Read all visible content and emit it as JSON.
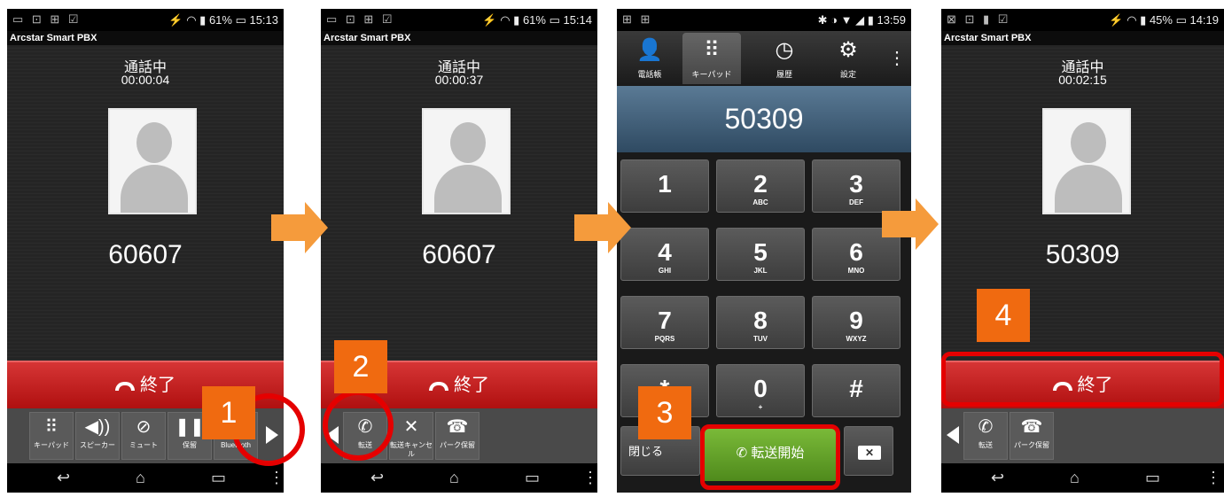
{
  "screen1": {
    "status_left": "▭ ⊡ ⊞ ☑",
    "status_right": "⚡ ◠ ▮ 61% ▭ 15:13",
    "app_title": "Arcstar Smart PBX",
    "call_status": "通話中",
    "timer": "00:00:04",
    "number": "60607",
    "end_label": "終了",
    "buttons": [
      {
        "label": "キーパッド",
        "icon": "keypad-icon"
      },
      {
        "label": "スピーカー",
        "icon": "speaker-icon"
      },
      {
        "label": "ミュート",
        "icon": "mute-icon"
      },
      {
        "label": "保留",
        "icon": "hold-icon"
      },
      {
        "label": "Bluetooth",
        "icon": "bluetooth-icon"
      }
    ]
  },
  "screen2": {
    "status_left": "▭ ⊡ ⊞ ☑",
    "status_right": "⚡ ◠ ▮ 61% ▭ 15:14",
    "app_title": "Arcstar Smart PBX",
    "call_status": "通話中",
    "timer": "00:00:37",
    "number": "60607",
    "end_label": "終了",
    "buttons": [
      {
        "label": "転送",
        "icon": "transfer-icon"
      },
      {
        "label": "転送キャンセル",
        "icon": "transfer-cancel-icon"
      },
      {
        "label": "パーク保留",
        "icon": "park-hold-icon"
      }
    ]
  },
  "screen3": {
    "status_left": "⊞ ⊞",
    "status_right": "✱ ◑ ▼ ◢ ▮ 13:59",
    "tabs": [
      {
        "label": "電話帳",
        "icon": "contacts-icon"
      },
      {
        "label": "キーパッド",
        "icon": "keypad-icon"
      },
      {
        "label": "履歴",
        "icon": "history-icon"
      },
      {
        "label": "設定",
        "icon": "settings-icon"
      }
    ],
    "display": "50309",
    "keys": [
      {
        "d": "1",
        "s": ""
      },
      {
        "d": "2",
        "s": "ABC"
      },
      {
        "d": "3",
        "s": "DEF"
      },
      {
        "d": "4",
        "s": "GHI"
      },
      {
        "d": "5",
        "s": "JKL"
      },
      {
        "d": "6",
        "s": "MNO"
      },
      {
        "d": "7",
        "s": "PQRS"
      },
      {
        "d": "8",
        "s": "TUV"
      },
      {
        "d": "9",
        "s": "WXYZ"
      },
      {
        "d": "*",
        "s": ""
      },
      {
        "d": "0",
        "s": "+"
      },
      {
        "d": "#",
        "s": ""
      }
    ],
    "close_label": "閉じる",
    "transfer_label": "転送開始"
  },
  "screen4": {
    "status_left": "⊠ ⊡ ▮ ☑",
    "status_right": "⚡ ◠ ▮ 45% ▭ 14:19",
    "app_title": "Arcstar Smart PBX",
    "call_status": "通話中",
    "timer": "00:02:15",
    "number": "50309",
    "end_label": "終了",
    "buttons": [
      {
        "label": "転送",
        "icon": "transfer-icon"
      },
      {
        "label": "パーク保留",
        "icon": "park-hold-icon"
      }
    ]
  },
  "steps": [
    "1",
    "2",
    "3",
    "4"
  ],
  "colors": {
    "step": "#f06a10",
    "arrow": "#f59b3c",
    "highlight": "#e50000",
    "end": "#c41e1e",
    "transfer": "#6aa82c"
  }
}
